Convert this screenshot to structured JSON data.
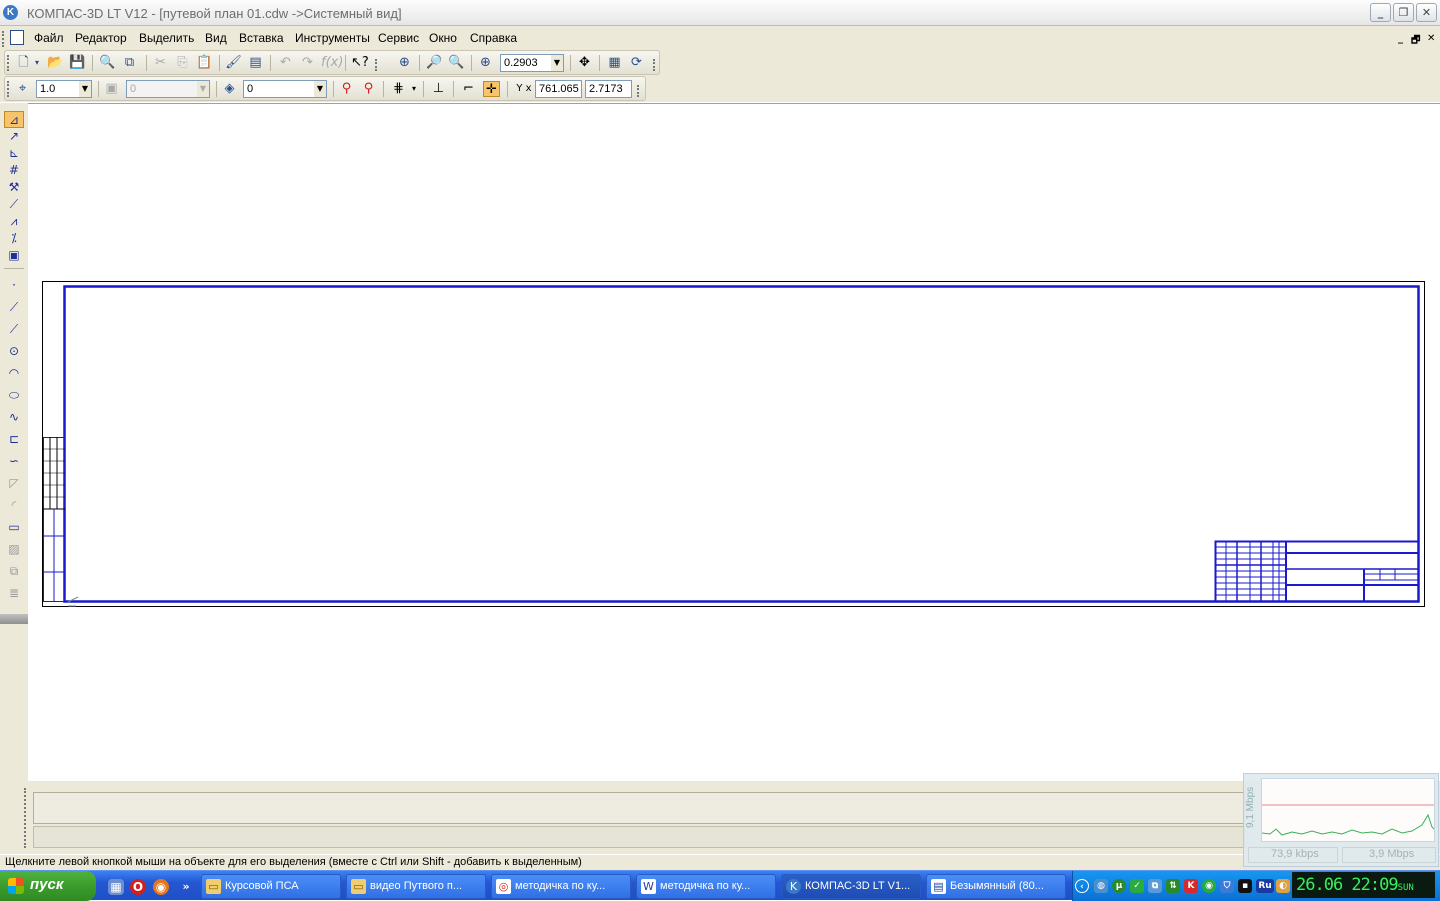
{
  "window": {
    "title": "КОМПАС-3D LT V12 - [путевой план 01.cdw ->Системный вид]",
    "logo_letter": "K",
    "buttons": {
      "minimize": "_",
      "restore": "❐",
      "close": "✕"
    }
  },
  "menu": {
    "items": [
      "Файл",
      "Редактор",
      "Выделить",
      "Вид",
      "Вставка",
      "Инструменты",
      "Сервис",
      "Окно",
      "Справка"
    ],
    "doc_buttons": {
      "minimize": "_",
      "restore": "🗗",
      "close": "✕"
    }
  },
  "toolbar_standard": {
    "zoom_value": "0.2903"
  },
  "toolbar_current_state": {
    "step_value": "1.0",
    "layer_state": "0",
    "layer_value": "0",
    "coord_label": "Y x",
    "coord_x": "761.065",
    "coord_y": "2.7173"
  },
  "status": {
    "message": "Щелкните левой кнопкой мыши на объекте для его выделения (вместе с Ctrl или Shift - добавить к выделенным)"
  },
  "netmon": {
    "scale": "9,1 Mbps",
    "download": "73,9 kbps",
    "upload": "3,9 Mbps"
  },
  "taskbar": {
    "start": "пуск",
    "tasks": [
      {
        "label": "Курсовой ПСА",
        "icon": "folder-icon"
      },
      {
        "label": "видео Путвого п...",
        "icon": "folder-icon"
      },
      {
        "label": "методичка по ку...",
        "icon": "pdf-icon"
      },
      {
        "label": "методичка по ку...",
        "icon": "word-icon"
      },
      {
        "label": "КОМПАС-3D LT V1...",
        "icon": "kompas-icon"
      },
      {
        "label": "Безымянный (80...",
        "icon": "image-icon"
      }
    ],
    "tray_lang": "Ru",
    "clock": "26.06 22:09",
    "clock_day": "SUN"
  },
  "colors": {
    "frame": "#1a1acc",
    "accent": "#f7c46a"
  }
}
